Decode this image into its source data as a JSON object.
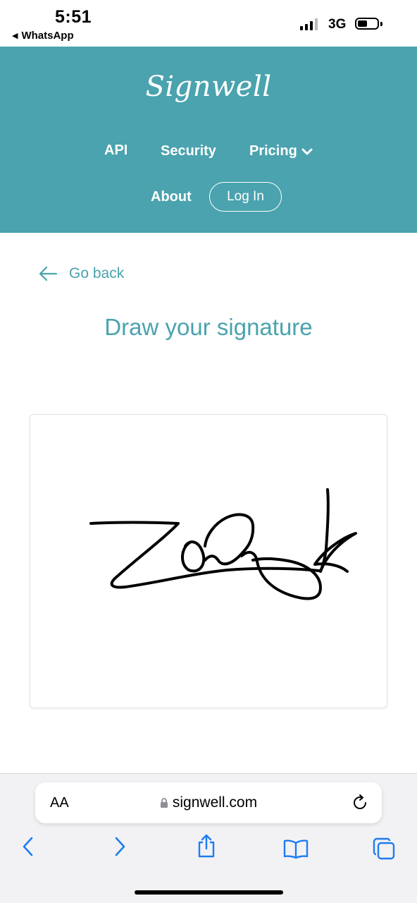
{
  "status_bar": {
    "time": "5:51",
    "back_app": "WhatsApp",
    "network": "3G"
  },
  "header": {
    "logo": "Signwell",
    "nav": {
      "api": "API",
      "security": "Security",
      "pricing": "Pricing",
      "about": "About",
      "login": "Log In"
    },
    "background_color": "#4aa3ae"
  },
  "content": {
    "go_back": "Go back",
    "title": "Draw your signature"
  },
  "browser": {
    "text_size_label": "AA",
    "url": "signwell.com"
  },
  "icons": [
    "back-arrow-icon",
    "chevron-down-icon",
    "lock-icon",
    "reload-icon",
    "safari-back-icon",
    "safari-forward-icon",
    "share-icon",
    "bookmarks-icon",
    "tabs-icon"
  ]
}
